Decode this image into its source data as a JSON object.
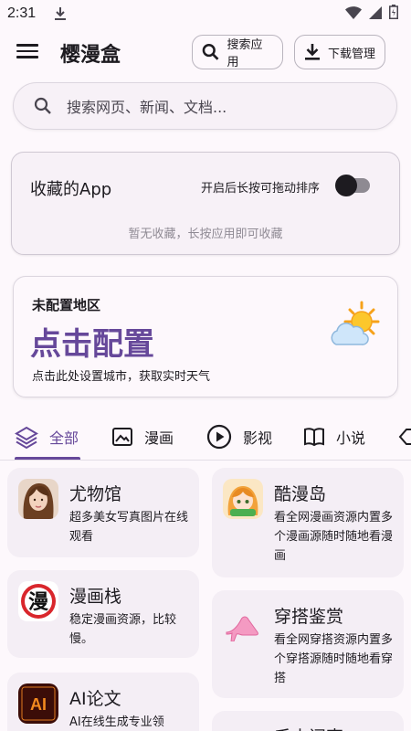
{
  "status_bar": {
    "time": "2:31"
  },
  "app_bar": {
    "title": "樱漫盒",
    "search_app_label": "搜索应用",
    "download_label": "下载管理"
  },
  "search": {
    "placeholder": "搜索网页、新闻、文档..."
  },
  "favorites": {
    "title": "收藏的App",
    "toggle_label": "开启后长按可拖动排序",
    "toggle_on": false,
    "empty_text": "暂无收藏，长按应用即可收藏"
  },
  "weather": {
    "region": "未配置地区",
    "cta": "点击配置",
    "hint": "点击此处设置城市，获取实时天气"
  },
  "tabs": [
    {
      "label": "全部",
      "icon": "layers-icon",
      "active": true
    },
    {
      "label": "漫画",
      "icon": "image-icon",
      "active": false
    },
    {
      "label": "影视",
      "icon": "play-circle-icon",
      "active": false
    },
    {
      "label": "小说",
      "icon": "book-icon",
      "active": false
    }
  ],
  "apps_left": [
    {
      "name": "尤物馆",
      "desc": "超多美女写真图片在线观看",
      "icon": "portrait-icon"
    },
    {
      "name": "漫画栈",
      "desc": "稳定漫画资源，比较慢。",
      "icon": "man-character-icon"
    },
    {
      "name": "AI论文",
      "desc": "AI在线生成专业领",
      "icon": "ai-logo-icon",
      "icon_text": "AI"
    }
  ],
  "apps_right": [
    {
      "name": "酷漫岛",
      "desc": "看全网漫画资源内置多个漫画源随时随地看漫画",
      "icon": "anime-girl-icon"
    },
    {
      "name": "穿搭鉴赏",
      "desc": "看全网穿搭资源内置多个穿搭源随时随地看穿搭",
      "icon": "high-heel-icon"
    },
    {
      "name": "千山阅声",
      "desc": "",
      "icon": "red-logo-icon"
    }
  ],
  "colors": {
    "accent": "#66489a",
    "background": "#fdf8fc",
    "card": "#f4eef5"
  }
}
